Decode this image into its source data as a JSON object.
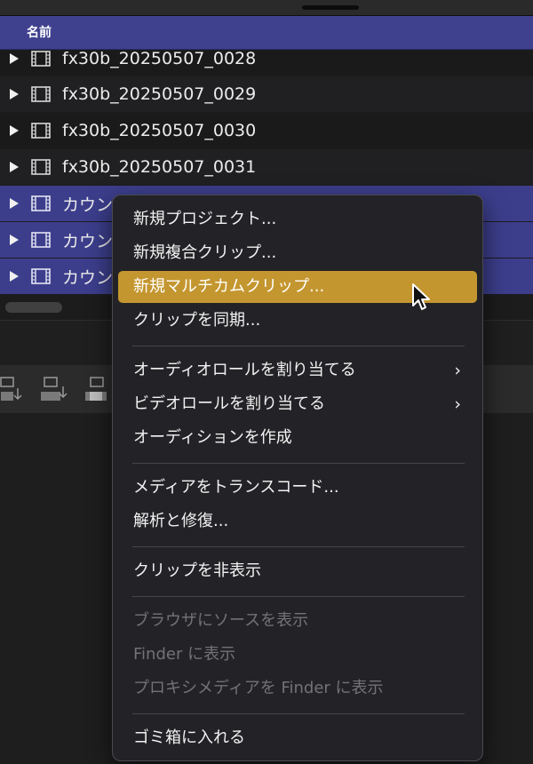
{
  "browser": {
    "column_header": "名前",
    "rows": [
      {
        "name": "fx30b_20250507_0028",
        "selected": false
      },
      {
        "name": "fx30b_20250507_0029",
        "selected": false
      },
      {
        "name": "fx30b_20250507_0030",
        "selected": false
      },
      {
        "name": "fx30b_20250507_0031",
        "selected": false
      },
      {
        "name": "カウン",
        "selected": true
      },
      {
        "name": "カウン",
        "selected": true
      },
      {
        "name": "カウン",
        "selected": true
      }
    ]
  },
  "colors": {
    "selection": "#3c3e8c",
    "header": "#3f418f",
    "menu_highlight": "#c4962f",
    "menu_background": "#232327",
    "disabled_text": "#727277"
  },
  "context_menu": {
    "groups": [
      [
        {
          "label": "新規プロジェクト...",
          "enabled": true
        },
        {
          "label": "新規複合クリップ...",
          "enabled": true
        },
        {
          "label": "新規マルチカムクリップ...",
          "enabled": true,
          "highlighted": true
        },
        {
          "label": "クリップを同期...",
          "enabled": true
        }
      ],
      [
        {
          "label": "オーディオロールを割り当てる",
          "enabled": true,
          "submenu": true
        },
        {
          "label": "ビデオロールを割り当てる",
          "enabled": true,
          "submenu": true
        },
        {
          "label": "オーディションを作成",
          "enabled": true
        }
      ],
      [
        {
          "label": "メディアをトランスコード...",
          "enabled": true
        },
        {
          "label": "解析と修復...",
          "enabled": true
        }
      ],
      [
        {
          "label": "クリップを非表示",
          "enabled": true
        }
      ],
      [
        {
          "label": "ブラウザにソースを表示",
          "enabled": false
        },
        {
          "label": "Finder に表示",
          "enabled": false
        },
        {
          "label": "プロキシメディアを Finder に表示",
          "enabled": false
        }
      ],
      [
        {
          "label": "ゴミ箱に入れる",
          "enabled": true
        }
      ]
    ]
  },
  "icons": {
    "disclosure": "disclosure-triangle-icon",
    "clip": "film-clip-icon",
    "submenu": "chevron-right-icon",
    "cursor": "mouse-pointer-icon"
  }
}
